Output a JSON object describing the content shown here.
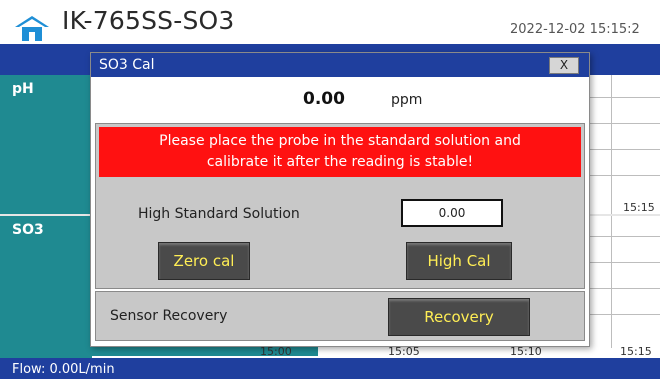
{
  "header": {
    "title": "IK-765SS-SO3",
    "timestamp": "2022-12-02 15:15:2"
  },
  "panels": {
    "ph_label": "pH",
    "so3_label": "SO3"
  },
  "chart": {
    "top_time_label": "15:15",
    "x_ticks": [
      "15:00",
      "15:05",
      "15:10",
      "15:15"
    ]
  },
  "footer": {
    "flow_text": "Flow:  0.00L/min"
  },
  "dialog": {
    "title": "SO3 Cal",
    "close_label": "X",
    "reading_value": "0.00",
    "reading_unit": "ppm",
    "notice_line1": "Please place the probe in the standard solution and",
    "notice_line2": "calibrate it after the reading is stable!",
    "std_label": "High Standard Solution",
    "std_value": "0.00",
    "zero_cal_label": "Zero cal",
    "high_cal_label": "High Cal",
    "recovery_label": "Sensor Recovery",
    "recovery_button": "Recovery"
  },
  "icons": {
    "home": "home-icon"
  },
  "colors": {
    "header_blue": "#1f3f9e",
    "panel_teal": "#1f8a91",
    "notice_red": "#ff1111",
    "button_text": "#ffee55"
  }
}
